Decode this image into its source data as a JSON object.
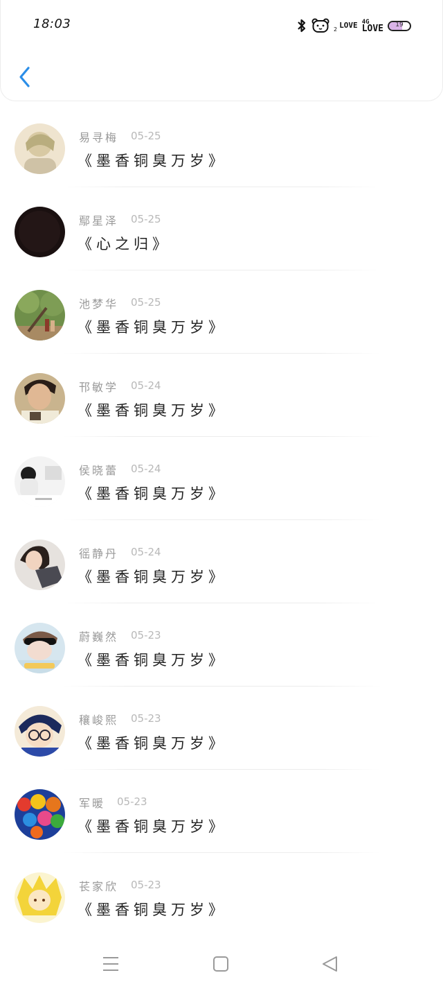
{
  "status_bar": {
    "time": "18:03",
    "icons": [
      "bluetooth-icon",
      "bear-face-icon",
      "love-signal-icon",
      "4g-love-signal-icon",
      "battery-icon"
    ],
    "love_label": "LOVE",
    "network_label": "4G",
    "battery_level": "19"
  },
  "header": {
    "back_icon": "chevron-left-icon",
    "accent_color": "#2b8ee8"
  },
  "entries": [
    {
      "name": "易寻梅",
      "date": "05-25",
      "title": "《墨香铜臭万岁》"
    },
    {
      "name": "鄢星泽",
      "date": "05-25",
      "title": "《心之归》"
    },
    {
      "name": "池梦华",
      "date": "05-25",
      "title": "《墨香铜臭万岁》"
    },
    {
      "name": "邗敏学",
      "date": "05-24",
      "title": "《墨香铜臭万岁》"
    },
    {
      "name": "侯晓蕾",
      "date": "05-24",
      "title": "《墨香铜臭万岁》"
    },
    {
      "name": "徭静丹",
      "date": "05-24",
      "title": "《墨香铜臭万岁》"
    },
    {
      "name": "蔚巍然",
      "date": "05-23",
      "title": "《墨香铜臭万岁》"
    },
    {
      "name": "穰峻熙",
      "date": "05-23",
      "title": "《墨香铜臭万岁》"
    },
    {
      "name": "军暖",
      "date": "05-23",
      "title": "《墨香铜臭万岁》"
    },
    {
      "name": "苌家欣",
      "date": "05-23",
      "title": "《墨香铜臭万岁》"
    }
  ],
  "nav_bar": {
    "icons": [
      "menu-icon",
      "home-square-icon",
      "back-triangle-icon"
    ]
  }
}
